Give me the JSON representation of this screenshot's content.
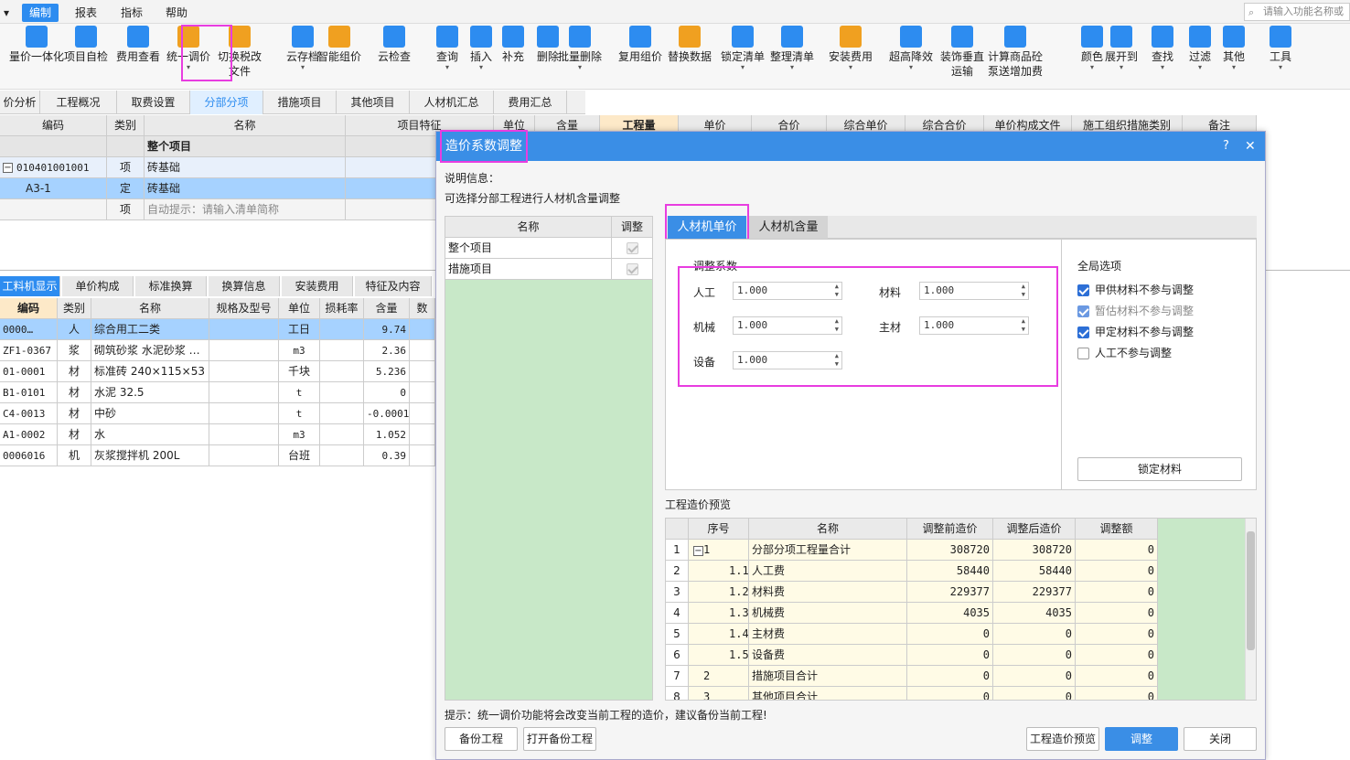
{
  "menubar": {
    "items": [
      "编制",
      "报表",
      "指标",
      "帮助"
    ],
    "search_placeholder": "请输入功能名称或"
  },
  "ribbon": {
    "items": [
      {
        "label": "量价一体化",
        "icon": "integration-icon"
      },
      {
        "label": "项目自检",
        "icon": "project-check-icon"
      },
      {
        "label": "费用查看",
        "icon": "fee-view-icon"
      },
      {
        "label": "统一调价",
        "icon": "unified-price-adjust-icon"
      },
      {
        "label": "切换税改",
        "label2": "文件",
        "icon": "tax-switch-icon"
      },
      {
        "label": "云存档",
        "icon": "cloud-archive-icon"
      },
      {
        "label": "智能组价",
        "icon": "smart-pricing-icon"
      },
      {
        "label": "云检查",
        "icon": "cloud-check-icon"
      },
      {
        "label": "查询",
        "icon": "query-icon"
      },
      {
        "label": "插入",
        "icon": "insert-icon"
      },
      {
        "label": "补充",
        "icon": "supplement-icon"
      },
      {
        "label": "删除",
        "icon": "delete-icon"
      },
      {
        "label": "批量删除",
        "icon": "batch-delete-icon"
      },
      {
        "label": "复用组价",
        "icon": "reuse-pricing-icon"
      },
      {
        "label": "替换数据",
        "icon": "replace-data-icon"
      },
      {
        "label": "锁定清单",
        "icon": "lock-list-icon"
      },
      {
        "label": "整理清单",
        "icon": "organize-list-icon"
      },
      {
        "label": "安装费用",
        "icon": "install-fee-icon"
      },
      {
        "label": "超高降效",
        "icon": "super-high-icon"
      },
      {
        "label": "装饰垂直",
        "label2": "运输",
        "icon": "vertical-transport-icon"
      },
      {
        "label": "计算商品砼",
        "label2": "泵送增加费",
        "icon": "concrete-pump-icon"
      },
      {
        "label": "颜色",
        "icon": "color-icon"
      },
      {
        "label": "展开到",
        "icon": "expand-icon"
      },
      {
        "label": "查找",
        "icon": "find-icon"
      },
      {
        "label": "过滤",
        "icon": "filter-icon"
      },
      {
        "label": "其他",
        "icon": "other-icon"
      },
      {
        "label": "工具",
        "icon": "tools-icon"
      }
    ]
  },
  "tabs": [
    "价分析",
    "工程概况",
    "取费设置",
    "分部分项",
    "措施项目",
    "其他项目",
    "人材机汇总",
    "费用汇总"
  ],
  "upper_grid": {
    "headers": [
      "编码",
      "类别",
      "名称",
      "项目特征",
      "单位",
      "含量",
      "工程量",
      "单价",
      "合价",
      "综合单价",
      "综合合价",
      "单价构成文件",
      "施工组织措施类别",
      "备注"
    ],
    "rows": [
      {
        "code": "",
        "type": "",
        "name": "整个项目"
      },
      {
        "code": "010401001001",
        "type": "项",
        "name": "砖基础"
      },
      {
        "code": "A3-1",
        "type": "定",
        "name": "砖基础"
      },
      {
        "code": "",
        "type": "项",
        "name": "自动提示：请输入清单简称"
      }
    ]
  },
  "lower_tabs": [
    "工料机显示",
    "单价构成",
    "标准换算",
    "换算信息",
    "安装费用",
    "特征及内容"
  ],
  "lower_grid": {
    "headers": [
      "编码",
      "类别",
      "名称",
      "规格及型号",
      "单位",
      "损耗率",
      "含量",
      "数"
    ],
    "rows": [
      {
        "code": "0000…",
        "type": "人",
        "name": "综合用工二类",
        "spec": "",
        "unit": "工日",
        "loss": "",
        "qty": "9.74"
      },
      {
        "code": "ZF1-0367",
        "type": "浆",
        "name": "砌筑砂浆 水泥砂浆 …",
        "spec": "",
        "unit": "m3",
        "loss": "",
        "qty": "2.36"
      },
      {
        "code": "01-0001",
        "type": "材",
        "name": "标准砖 240×115×53",
        "spec": "",
        "unit": "千块",
        "loss": "",
        "qty": "5.236"
      },
      {
        "code": "B1-0101",
        "type": "材",
        "name": "水泥 32.5",
        "spec": "",
        "unit": "t",
        "loss": "",
        "qty": "0"
      },
      {
        "code": "C4-0013",
        "type": "材",
        "name": "中砂",
        "spec": "",
        "unit": "t",
        "loss": "",
        "qty": "-0.0001"
      },
      {
        "code": "A1-0002",
        "type": "材",
        "name": "水",
        "spec": "",
        "unit": "m3",
        "loss": "",
        "qty": "1.052"
      },
      {
        "code": "0006016",
        "type": "机",
        "name": "灰浆搅拌机 200L",
        "spec": "",
        "unit": "台班",
        "loss": "",
        "qty": "0.39"
      }
    ]
  },
  "dialog": {
    "title": "造价系数调整",
    "help": "?",
    "close": "✕",
    "info_label": "说明信息：",
    "info_text": "可选择分部工程进行人材机含量调整",
    "scope_headers": [
      "名称",
      "调整"
    ],
    "scope_rows": [
      "整个项目",
      "措施项目"
    ],
    "tabs": [
      "人材机单价",
      "人材机含量"
    ],
    "coef_title": "调整系数",
    "coef": {
      "labor_label": "人工",
      "labor": "1.000",
      "material_label": "材料",
      "material": "1.000",
      "machine_label": "机械",
      "machine": "1.000",
      "main_label": "主材",
      "main": "1.000",
      "equip_label": "设备",
      "equip": "1.000"
    },
    "global_title": "全局选项",
    "global_opts": [
      {
        "label": "甲供材料不参与调整",
        "checked": true
      },
      {
        "label": "暂估材料不参与调整",
        "checked": true,
        "disabled": true
      },
      {
        "label": "甲定材料不参与调整",
        "checked": true
      },
      {
        "label": "人工不参与调整",
        "checked": false
      }
    ],
    "lock_btn": "锁定材料",
    "preview_title": "工程造价预览",
    "preview_headers": [
      "序号",
      "名称",
      "调整前造价",
      "调整后造价",
      "调整额"
    ],
    "preview_rows": [
      {
        "idx": "1",
        "seq": "1",
        "name": "分部分项工程量合计",
        "before": "308720",
        "after": "308720",
        "diff": "0",
        "level": 0
      },
      {
        "idx": "2",
        "seq": "1.1",
        "name": "人工费",
        "before": "58440",
        "after": "58440",
        "diff": "0",
        "level": 1
      },
      {
        "idx": "3",
        "seq": "1.2",
        "name": "材料费",
        "before": "229377",
        "after": "229377",
        "diff": "0",
        "level": 1
      },
      {
        "idx": "4",
        "seq": "1.3",
        "name": "机械费",
        "before": "4035",
        "after": "4035",
        "diff": "0",
        "level": 1
      },
      {
        "idx": "5",
        "seq": "1.4",
        "name": "主材费",
        "before": "0",
        "after": "0",
        "diff": "0",
        "level": 1
      },
      {
        "idx": "6",
        "seq": "1.5",
        "name": "设备费",
        "before": "0",
        "after": "0",
        "diff": "0",
        "level": 1
      },
      {
        "idx": "7",
        "seq": "2",
        "name": "措施项目合计",
        "before": "0",
        "after": "0",
        "diff": "0",
        "level": 0
      },
      {
        "idx": "8",
        "seq": "3",
        "name": "其他项目合计",
        "before": "0",
        "after": "0",
        "diff": "0",
        "level": 0
      }
    ],
    "hint": "提示：统一调价功能将会改变当前工程的造价，建议备份当前工程!",
    "buttons": {
      "backup": "备份工程",
      "open_backup": "打开备份工程",
      "preview": "工程造价预览",
      "adjust": "调整",
      "close": "关闭"
    }
  },
  "colors": {
    "accent": "#3a8ee6",
    "highlight": "#e83de0",
    "selected_row": "#a6d2ff",
    "scope_bg": "#c8e8c8"
  }
}
